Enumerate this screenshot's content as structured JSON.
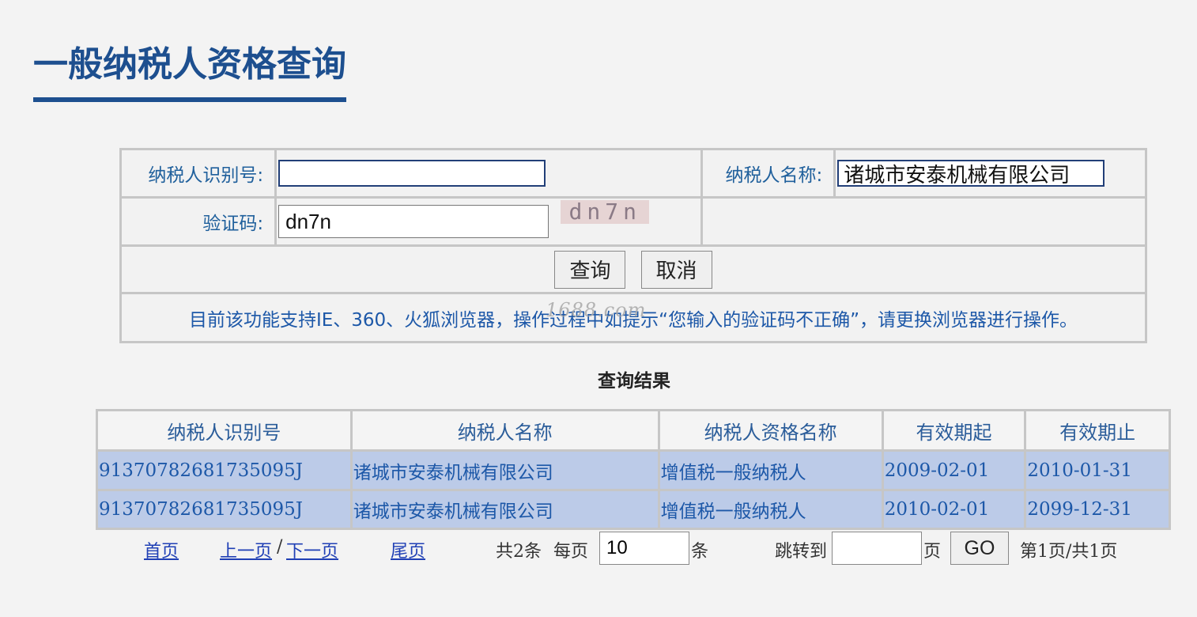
{
  "page": {
    "title": "一般纳税人资格查询"
  },
  "form": {
    "taxpayer_id_label": "纳税人识别号:",
    "taxpayer_id_value": "",
    "taxpayer_name_label": "纳税人名称:",
    "taxpayer_name_value": "诸城市安泰机械有限公司",
    "captcha_label": "验证码:",
    "captcha_value": "dn7n",
    "captcha_image_text": "dn7n",
    "query_button": "查询",
    "cancel_button": "取消",
    "notice": "目前该功能支持IE、360、火狐浏览器，操作过程中如提示“您输入的验证码不正确”，请更换浏览器进行操作。",
    "watermark": "1688.com"
  },
  "results": {
    "title": "查询结果",
    "columns": [
      "纳税人识别号",
      "纳税人名称",
      "纳税人资格名称",
      "有效期起",
      "有效期止"
    ],
    "rows": [
      [
        "91370782681735095J",
        "诸城市安泰机械有限公司",
        "增值税一般纳税人",
        "2009-02-01",
        "2010-01-31"
      ],
      [
        "91370782681735095J",
        "诸城市安泰机械有限公司",
        "增值税一般纳税人",
        "2010-02-01",
        "2099-12-31"
      ]
    ]
  },
  "pager": {
    "first": "首页",
    "prev": "上一页",
    "sep": "/",
    "next": "下一页",
    "last": "尾页",
    "total": "共2条",
    "per_page_label": "每页",
    "per_page_value": "10",
    "per_page_unit": "条",
    "jump_label": "跳转到",
    "jump_value": "",
    "page_unit": "页",
    "go_button": "GO",
    "status": "第1页/共1页"
  }
}
